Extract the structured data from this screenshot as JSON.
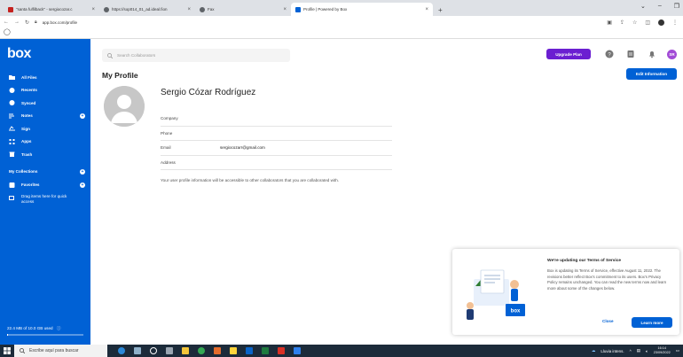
{
  "browser": {
    "tabs": [
      {
        "title": "\"santa fulfilback\" - sergiocozar.c",
        "favicon_color": "#c5221f",
        "active": false
      },
      {
        "title": "https://sop014_01_ad.ideal.fion",
        "favicon_color": "#5f6368",
        "active": false
      },
      {
        "title": "Fax",
        "favicon_color": "#5f6368",
        "active": false
      },
      {
        "title": "Profile | Powered by Box",
        "favicon_color": "#0061d5",
        "active": true
      }
    ],
    "new_tab": "+",
    "url": "app.box.com/profile"
  },
  "sidebar": {
    "logo": "box",
    "nav": [
      {
        "label": "All Files",
        "icon": "folder-icon"
      },
      {
        "label": "Recents",
        "icon": "clock-icon"
      },
      {
        "label": "Synced",
        "icon": "check-circle-icon"
      },
      {
        "label": "Notes",
        "icon": "notes-icon",
        "add": true
      },
      {
        "label": "Sign",
        "icon": "sign-icon"
      },
      {
        "label": "Apps",
        "icon": "apps-grid-icon"
      },
      {
        "label": "Trash",
        "icon": "trash-icon"
      }
    ],
    "collections_label": "My Collections",
    "favorites_label": "Favorites",
    "drag_hint": "Drag items here for quick access",
    "storage": "22.4 MB of 10.0 GB used",
    "storage_fraction": 0.002
  },
  "header": {
    "search_placeholder": "Search Collaborators",
    "upgrade_label": "Upgrade Plan",
    "avatar_initials": "SR"
  },
  "profile": {
    "page_title": "My Profile",
    "edit_label": "Edit Information",
    "name": "Sergio Cózar Rodríguez",
    "fields": [
      {
        "label": "Company",
        "value": ""
      },
      {
        "label": "Phone",
        "value": ""
      },
      {
        "label": "Email",
        "value": "sergiocozarr@gmail.com"
      },
      {
        "label": "Address",
        "value": ""
      }
    ],
    "note": "Your user profile information will be accessible to other collaborators that you are collaborated with."
  },
  "terms": {
    "title": "We're updating our Terms of Service",
    "body": "Box is updating its Terms of Service, effective August 11, 2022. The revisions better reflect Box's commitment to its users. Box's Privacy Policy remains unchanged. You can read the new terms now and learn more about some of the changes below.",
    "close_label": "Close",
    "learn_label": "Learn more"
  },
  "taskbar": {
    "search_text": "Escribe aquí para buscar",
    "weather": "Lluvia intens.",
    "time": "16:14",
    "date": "23/09/2022"
  }
}
